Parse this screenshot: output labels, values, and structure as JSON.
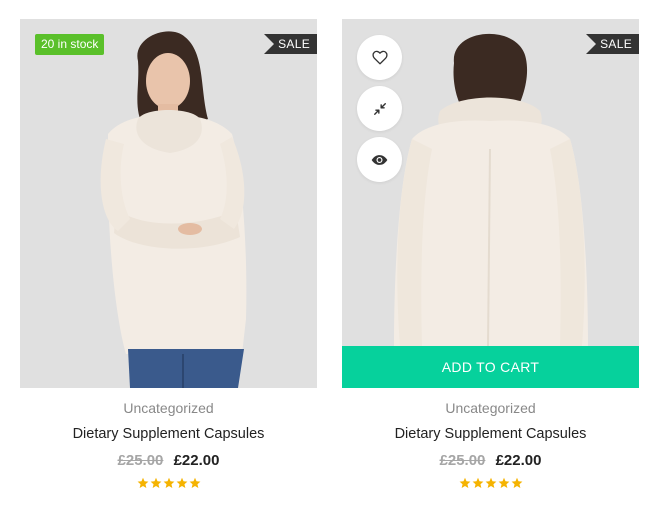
{
  "colors": {
    "stock_badge": "#5ac02a",
    "sale_badge": "#333333",
    "add_to_cart": "#06d19c",
    "star": "#f5b301",
    "image_bg": "#e0e0e0"
  },
  "products": [
    {
      "stock_badge": "20 in stock",
      "sale_badge": "SALE",
      "category": "Uncategorized",
      "title": "Dietary Supplement Capsules",
      "old_price": "£25.00",
      "price": "£22.00",
      "rating": 5,
      "image_icon": "woman-sweater-front-photo"
    },
    {
      "sale_badge": "SALE",
      "category": "Uncategorized",
      "title": "Dietary Supplement Capsules",
      "old_price": "£25.00",
      "price": "£22.00",
      "rating": 5,
      "image_icon": "woman-sweater-back-photo",
      "actions": {
        "wishlist_icon": "heart-icon",
        "compare_icon": "compress-arrows-icon",
        "quickview_icon": "eye-icon"
      },
      "add_to_cart_label": "ADD TO CART"
    }
  ]
}
